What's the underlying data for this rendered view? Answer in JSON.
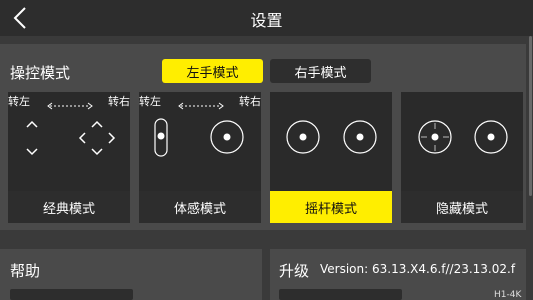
{
  "header": {
    "title": "设置",
    "back_icon": "back-arrow-icon"
  },
  "control": {
    "label": "操控模式",
    "left_hand_label": "左手模式",
    "right_hand_label": "右手模式",
    "active_hand": "left",
    "turn_left": "转左",
    "turn_right": "转右",
    "cards": [
      {
        "label": "经典模式",
        "selected": false
      },
      {
        "label": "体感模式",
        "selected": false
      },
      {
        "label": "摇杆模式",
        "selected": true
      },
      {
        "label": "隐藏模式",
        "selected": false
      }
    ]
  },
  "help": {
    "title": "帮助"
  },
  "upgrade": {
    "title": "升级",
    "version": "Version: 63.13.X4.6.f//23.13.02.f",
    "partial_text": "H1-4K"
  },
  "colors": {
    "accent": "#ffee00",
    "background": "#3a3a3a",
    "panel": "#4a4a4a"
  }
}
